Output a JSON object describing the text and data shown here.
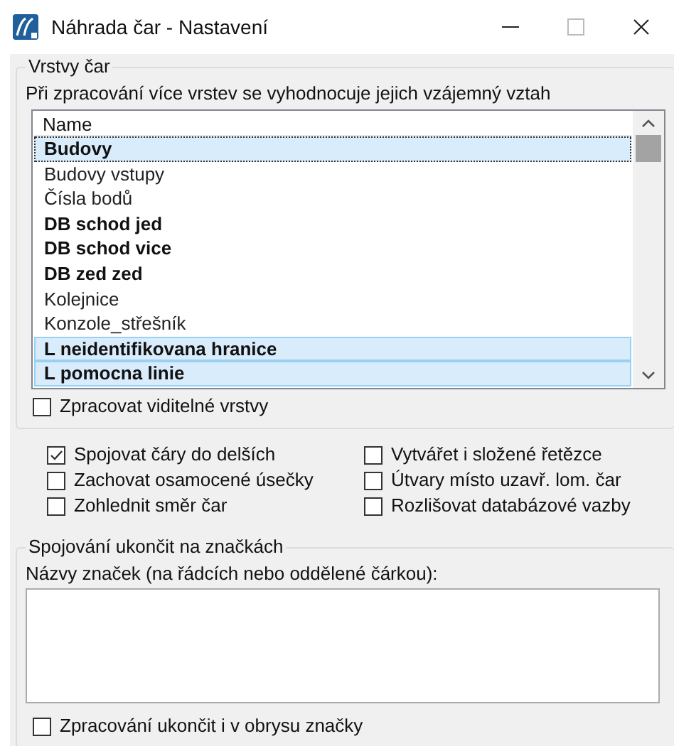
{
  "window": {
    "title": "Náhrada čar - Nastavení"
  },
  "layers_group": {
    "title": "Vrstvy čar",
    "description": "Při zpracování více vrstev se vyhodnocuje jejich vzájemný vztah",
    "list": {
      "column": "Name",
      "items": [
        {
          "label": "Budovy",
          "bold": true,
          "selected": true,
          "focused": true
        },
        {
          "label": "Budovy vstupy",
          "bold": false,
          "selected": false,
          "focused": false
        },
        {
          "label": "Čísla bodů",
          "bold": false,
          "selected": false,
          "focused": false
        },
        {
          "label": "DB schod jed",
          "bold": true,
          "selected": false,
          "focused": false
        },
        {
          "label": "DB schod vice",
          "bold": true,
          "selected": false,
          "focused": false
        },
        {
          "label": "DB zed zed",
          "bold": true,
          "selected": false,
          "focused": false
        },
        {
          "label": "Kolejnice",
          "bold": false,
          "selected": false,
          "focused": false
        },
        {
          "label": "Konzole_střešník",
          "bold": false,
          "selected": false,
          "focused": false
        },
        {
          "label": "L neidentifikovana hranice",
          "bold": true,
          "selected": true,
          "focused": false
        },
        {
          "label": "L pomocna linie",
          "bold": true,
          "selected": true,
          "focused": false
        }
      ]
    },
    "visible_layers": {
      "label": "Zpracovat viditelné vrstvy",
      "checked": false
    }
  },
  "options": [
    {
      "label": "Spojovat čáry do delších",
      "checked": true
    },
    {
      "label": "Vytvářet i složené řetězce",
      "checked": false
    },
    {
      "label": "Zachovat osamocené úsečky",
      "checked": false
    },
    {
      "label": "Útvary místo uzavř. lom. čar",
      "checked": false
    },
    {
      "label": "Zohlednit směr čar",
      "checked": false
    },
    {
      "label": "Rozlišovat databázové vazby",
      "checked": false
    }
  ],
  "marks_group": {
    "title": "Spojování ukončit na značkách",
    "field_label": "Názvy značek (na řádcích nebo oddělené čárkou):",
    "outline": {
      "label": "Zpracování ukončit i v obrysu značky",
      "checked": false
    }
  }
}
